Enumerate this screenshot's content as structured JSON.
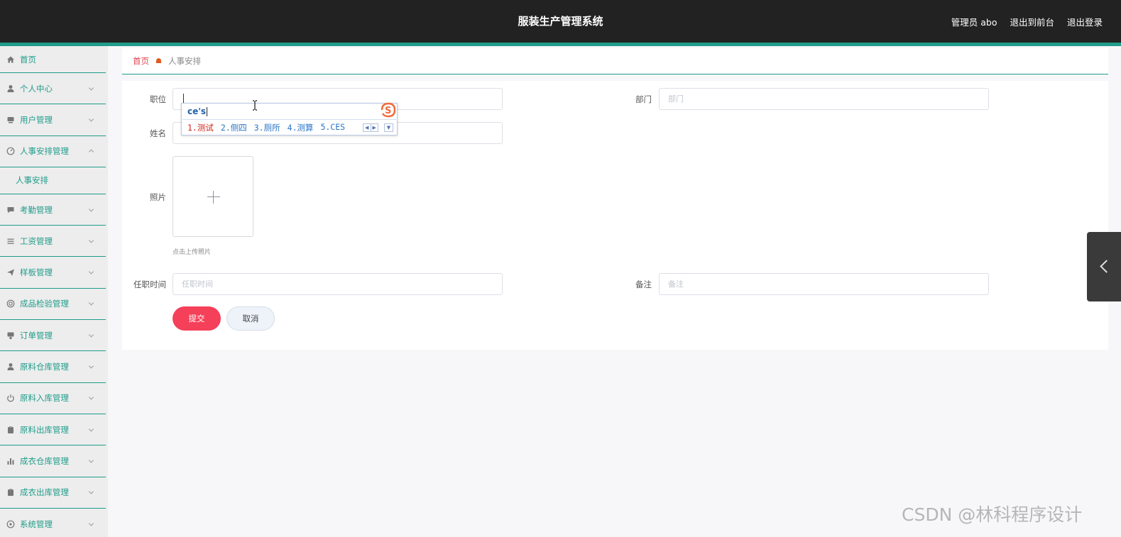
{
  "header": {
    "title": "服装生产管理系统",
    "user_label": "管理员 abo",
    "back_label": "退出到前台",
    "logout_label": "退出登录"
  },
  "sidebar": {
    "items": [
      {
        "label": "首页",
        "icon": "home-icon"
      },
      {
        "label": "个人中心",
        "icon": "user-icon"
      },
      {
        "label": "用户管理",
        "icon": "users-icon"
      },
      {
        "label": "人事安排管理",
        "icon": "dashboard-icon",
        "expanded": true,
        "children": [
          {
            "label": "人事安排"
          }
        ]
      },
      {
        "label": "考勤管理",
        "icon": "chat-icon"
      },
      {
        "label": "工资管理",
        "icon": "list-icon"
      },
      {
        "label": "样板管理",
        "icon": "send-icon"
      },
      {
        "label": "成品检验管理",
        "icon": "target-icon"
      },
      {
        "label": "订单管理",
        "icon": "order-icon"
      },
      {
        "label": "原料仓库管理",
        "icon": "user-icon"
      },
      {
        "label": "原料入库管理",
        "icon": "power-icon"
      },
      {
        "label": "原料出库管理",
        "icon": "clipboard-icon"
      },
      {
        "label": "成衣仓库管理",
        "icon": "bar-chart-icon"
      },
      {
        "label": "成衣出库管理",
        "icon": "clipboard-icon"
      },
      {
        "label": "系统管理",
        "icon": "settings-icon"
      }
    ]
  },
  "breadcrumb": {
    "home": "首页",
    "current": "人事安排"
  },
  "form": {
    "position_label": "职位",
    "position_value": "",
    "department_label": "部门",
    "department_placeholder": "部门",
    "name_label": "姓名",
    "photo_label": "照片",
    "photo_tip": "点击上传照片",
    "hire_time_label": "任职时间",
    "hire_time_placeholder": "任职时间",
    "remark_label": "备注",
    "remark_placeholder": "备注",
    "submit_label": "提交",
    "cancel_label": "取消"
  },
  "ime": {
    "composition": "ce's",
    "candidates": [
      "1.测试",
      "2.侧四",
      "3.厕所",
      "4.测算",
      "5.CES"
    ]
  },
  "watermark": "CSDN @林科程序设计",
  "colors": {
    "accent": "#1f9c8a",
    "topbar": "#222222",
    "submit": "#f5405a"
  }
}
